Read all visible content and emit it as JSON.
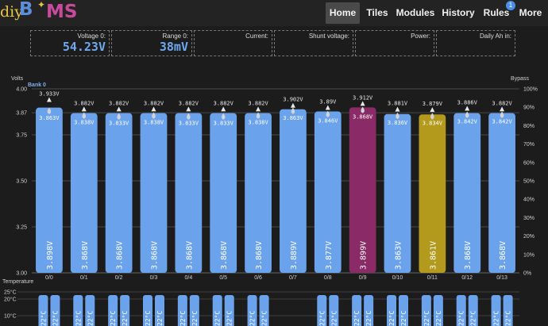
{
  "logo": {
    "part1": "diy",
    "part2": "B",
    "part3": "MS"
  },
  "nav": [
    {
      "label": "Home",
      "active": true
    },
    {
      "label": "Tiles",
      "active": false
    },
    {
      "label": "Modules",
      "active": false
    },
    {
      "label": "History",
      "active": false
    },
    {
      "label": "Rules",
      "active": false,
      "badge": "1"
    },
    {
      "label": "More",
      "active": false
    }
  ],
  "info": [
    {
      "label": "Voltage 0:",
      "value": "54.23V"
    },
    {
      "label": "Range 0:",
      "value": "38mV"
    },
    {
      "label": "Current:",
      "value": ""
    },
    {
      "label": "Shunt voltage:",
      "value": ""
    },
    {
      "label": "Power:",
      "value": ""
    },
    {
      "label": "Daily Ah in:",
      "value": ""
    }
  ],
  "colors": {
    "bar": "#6aa2ec",
    "bar_high": "#8a2a66",
    "bar_low": "#b39a1c",
    "temp_bar": "#6aa2ec",
    "background": "#1c1c1c"
  },
  "chart_data": {
    "type": "bar",
    "left_axis_label": "Volts",
    "right_axis_label": "Bypass",
    "bank_label": "Bank 0",
    "temp_axis_label": "Temperature",
    "left_ticks": [
      "4.00",
      "3.87",
      "3.75",
      "3.50",
      "3.25",
      "3.00"
    ],
    "left_tick_values": [
      4.0,
      3.87,
      3.75,
      3.5,
      3.25,
      3.0
    ],
    "right_ticks": [
      "100%",
      "90%",
      "80%",
      "70%",
      "60%",
      "50%",
      "40%",
      "30%",
      "20%",
      "10%",
      "0%"
    ],
    "ylim": [
      3.0,
      4.0
    ],
    "categories": [
      "0/0",
      "0/1",
      "0/2",
      "0/3",
      "0/4",
      "0/5",
      "0/6",
      "0/7",
      "0/8",
      "0/9",
      "0/10",
      "0/11",
      "0/12",
      "0/13"
    ],
    "voltage": [
      3.898,
      3.868,
      3.868,
      3.868,
      3.868,
      3.868,
      3.868,
      3.889,
      3.877,
      3.899,
      3.863,
      3.861,
      3.868,
      3.868
    ],
    "voltage_labels": [
      "3.898V",
      "3.868V",
      "3.868V",
      "3.868V",
      "3.868V",
      "3.868V",
      "3.868V",
      "3.889V",
      "3.877V",
      "3.899V",
      "3.863V",
      "3.861V",
      "3.868V",
      "3.868V"
    ],
    "max_labels": [
      "3.933V",
      "3.882V",
      "3.882V",
      "3.882V",
      "3.882V",
      "3.882V",
      "3.882V",
      "3.902V",
      "3.89V",
      "3.912V",
      "3.881V",
      "3.879V",
      "3.886V",
      "3.882V"
    ],
    "max_values": [
      3.933,
      3.882,
      3.882,
      3.882,
      3.882,
      3.882,
      3.882,
      3.902,
      3.89,
      3.912,
      3.881,
      3.879,
      3.886,
      3.882
    ],
    "min_labels": [
      "3.863V",
      "3.838V",
      "3.833V",
      "3.838V",
      "3.833V",
      "3.833V",
      "3.838V",
      "3.863V",
      "3.846V",
      "3.868V",
      "3.836V",
      "3.834V",
      "3.842V",
      "3.842V"
    ],
    "min_values": [
      3.863,
      3.838,
      3.833,
      3.838,
      3.833,
      3.833,
      3.838,
      3.863,
      3.846,
      3.868,
      3.836,
      3.834,
      3.842,
      3.842
    ],
    "highlight": [
      "",
      "",
      "",
      "",
      "",
      "",
      "",
      "",
      "",
      "high",
      "",
      "low",
      "",
      ""
    ],
    "temp_ticks": [
      "25°C",
      "20°C",
      "10°C"
    ],
    "temp_label": "22°C",
    "temp_visible": [
      true,
      true,
      true,
      true,
      true,
      true,
      true,
      false,
      true,
      true,
      true,
      true,
      true,
      true
    ],
    "grid": true
  }
}
